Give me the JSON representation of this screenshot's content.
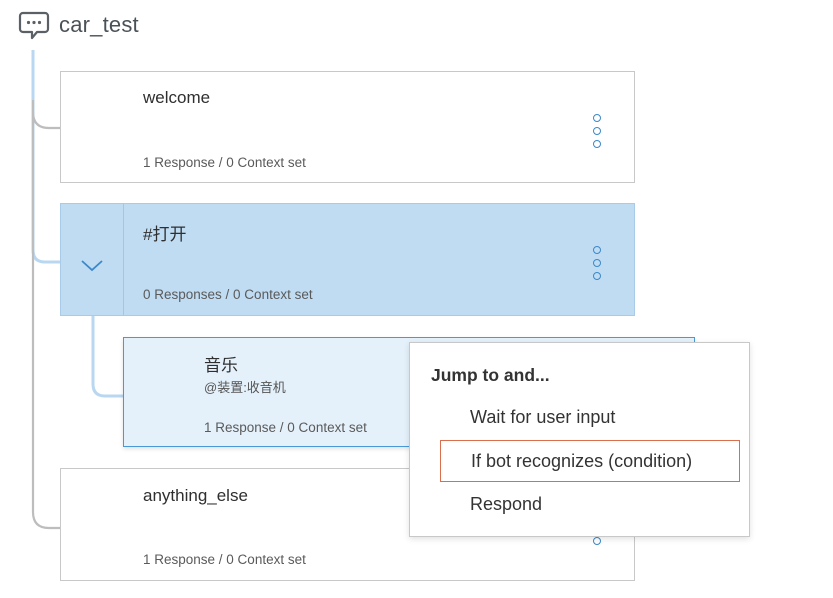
{
  "header": {
    "title": "car_test",
    "icon": "chat-bubble-icon"
  },
  "nodes": [
    {
      "name": "welcome",
      "condition": "",
      "meta": "1 Response / 0 Context set"
    },
    {
      "name": "#打开",
      "condition": "",
      "meta": "0 Responses / 0 Context set"
    },
    {
      "name": "音乐",
      "condition": "@装置:收音机",
      "meta": "1 Response / 0 Context set"
    },
    {
      "name": "anything_else",
      "condition": "",
      "meta": "1 Response / 0 Context set"
    }
  ],
  "popup": {
    "title": "Jump to and...",
    "options": [
      "Wait for user input",
      "If bot recognizes (condition)",
      "Respond"
    ],
    "selected": "If bot recognizes (condition)"
  },
  "colors": {
    "accent": "#3b89c9",
    "selected_node": "#c0dcf3",
    "active_node": "#e4f1fb",
    "highlight_border": "#d96f4f"
  }
}
